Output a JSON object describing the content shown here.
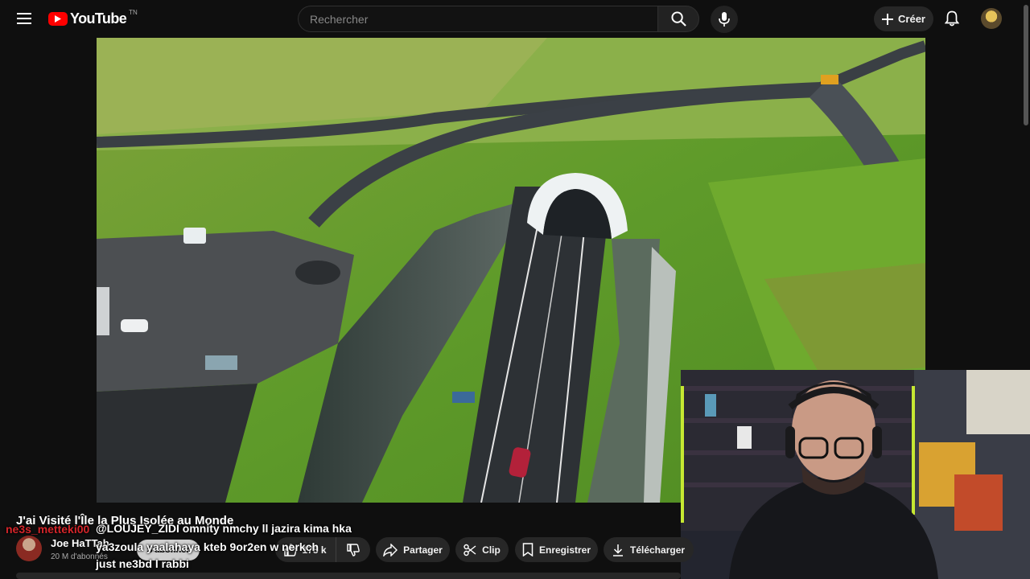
{
  "header": {
    "logo_text": "YouTube",
    "logo_country": "TN",
    "search_placeholder": "Rechercher",
    "create_label": "Créer",
    "icons": [
      "menu-icon",
      "search-icon",
      "mic-icon",
      "plus-icon",
      "bell-icon"
    ]
  },
  "video": {
    "title": "J'ai Visité l'Île la Plus Isolée au Monde",
    "channel_name": "Joe HaTTab",
    "subscribers": "20 M d'abonnés",
    "subscribe_label": "S'abonner",
    "likes": "175 k",
    "share_label": "Partager",
    "clip_label": "Clip",
    "save_label": "Enregistrer",
    "download_label": "Télécharger"
  },
  "chat": {
    "user": "ne3s_metteki00",
    "line1": "@LOUJEY_ZIDI omnity nmchy ll jazira kima hka",
    "line2": "ya3zoula yaalahaya kteb 9or2en w nerkch",
    "line3": "just ne3bd l rabbi"
  },
  "colors": {
    "background": "#0f0f0f",
    "brand_red": "#ff0000",
    "chat_user": "#d4252a",
    "pill": "#272727"
  }
}
